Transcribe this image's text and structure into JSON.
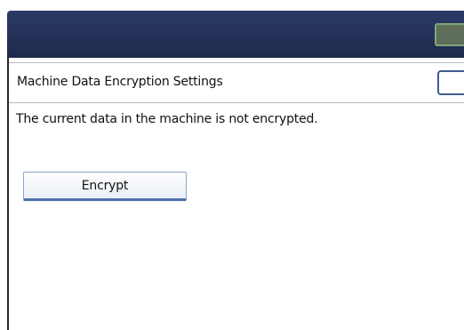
{
  "screen": {
    "title": "Machine Data Encryption Settings",
    "message": "The current data in the machine is not encrypted.",
    "encrypt_button_label": "Encrypt"
  },
  "colors": {
    "header_background": "#24325a",
    "button_border_accent": "#4d6fa8",
    "header_button_border": "#7fa67a"
  }
}
